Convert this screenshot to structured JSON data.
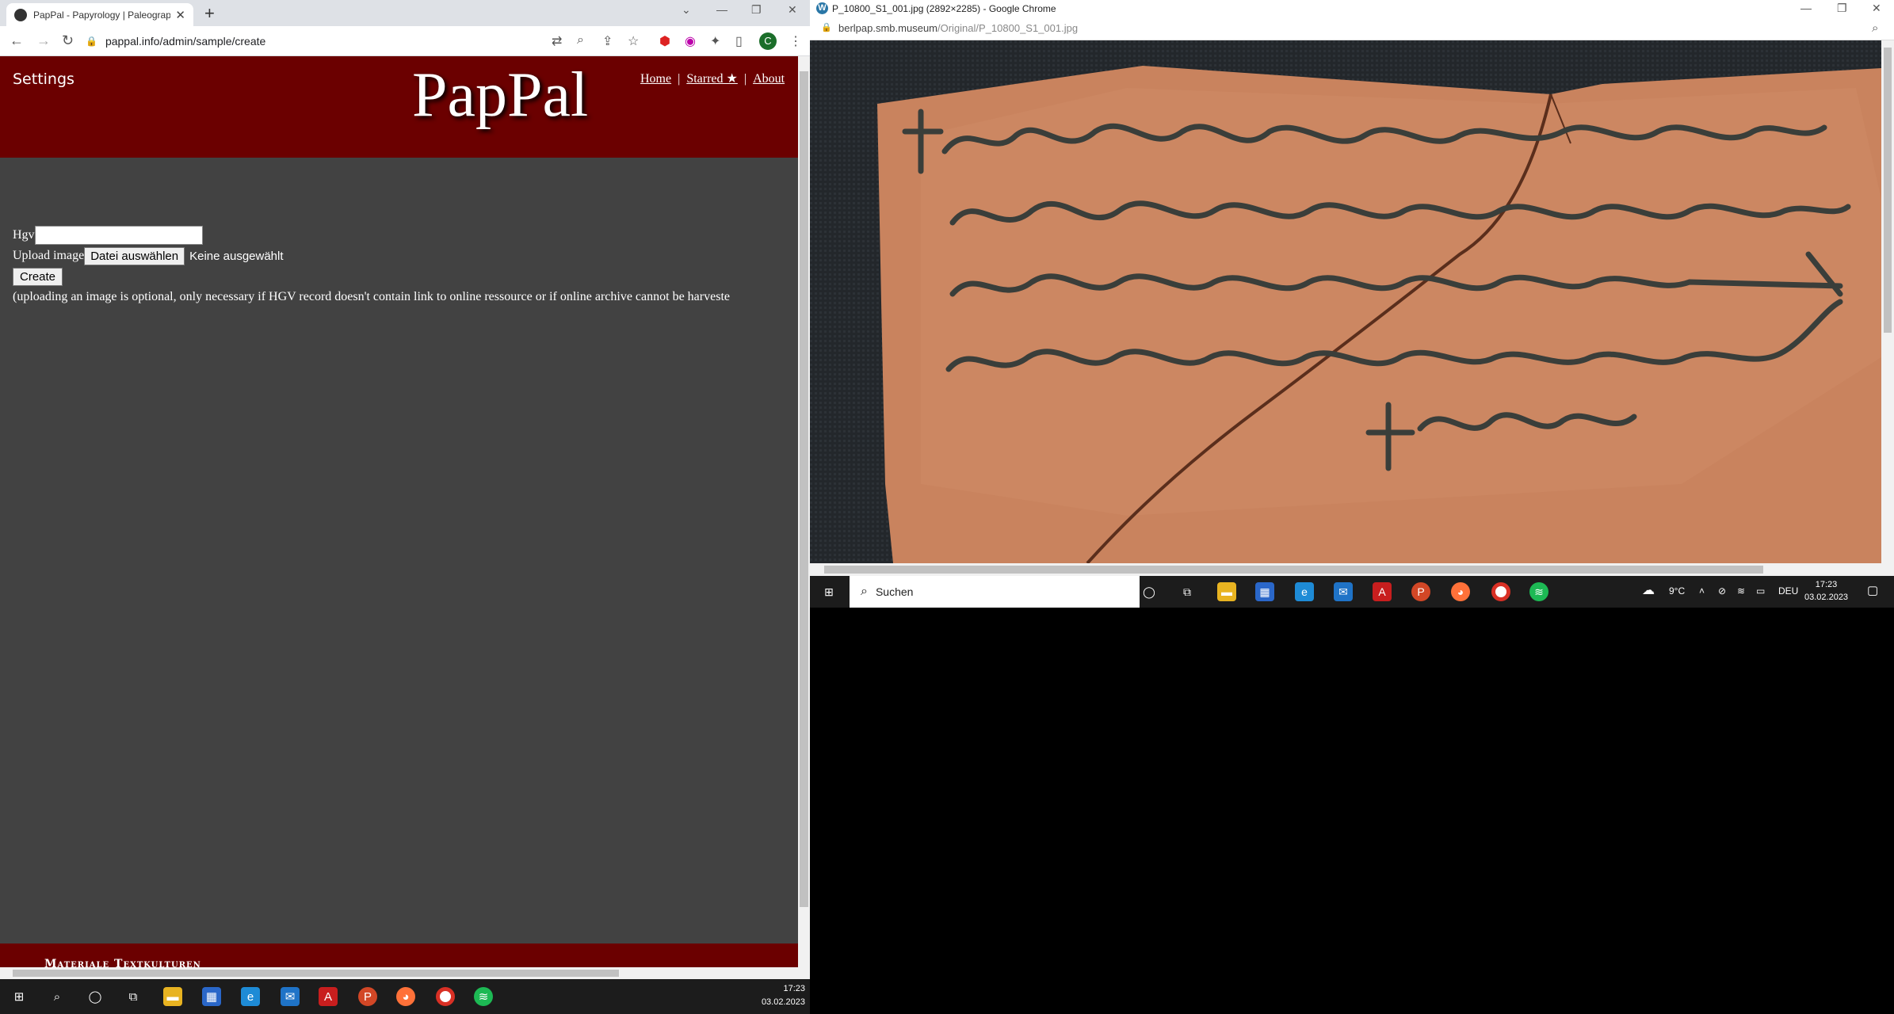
{
  "left_browser": {
    "tab_title": "PapPal - Papyrology | Paleograph",
    "url": "pappal.info/admin/sample/create"
  },
  "site": {
    "settings_label": "Settings",
    "logo": "PapPal",
    "nav": [
      "Home",
      "Starred ★",
      "About"
    ],
    "footer": "Materiale Textkulturen"
  },
  "form": {
    "hgv_label": "Hgv",
    "hgv_value": "",
    "upload_label": "Upload image",
    "file_button": "Datei auswählen",
    "file_status": "Keine ausgewählt",
    "create_button": "Create",
    "note": "(uploading an image is optional, only necessary if HGV record doesn't contain link to online ressource or if online archive cannot be harveste"
  },
  "taskbar_left": {
    "time": "17:23",
    "date": "03.02.2023"
  },
  "right_browser": {
    "title": "P_10800_S1_001.jpg (2892×2285) - Google Chrome",
    "url_host": "berlpap.smb.museum",
    "url_path": "/Original/P_10800_S1_001.jpg"
  },
  "taskbar_right": {
    "search_placeholder": "Suchen",
    "weather": "9°C",
    "language": "DEU",
    "time": "17:23",
    "date": "03.02.2023"
  },
  "colors": {
    "site_header": "#6b0000",
    "page_bg": "#424242",
    "ostracon": "#c9835e",
    "ink": "#3a3e3a"
  }
}
